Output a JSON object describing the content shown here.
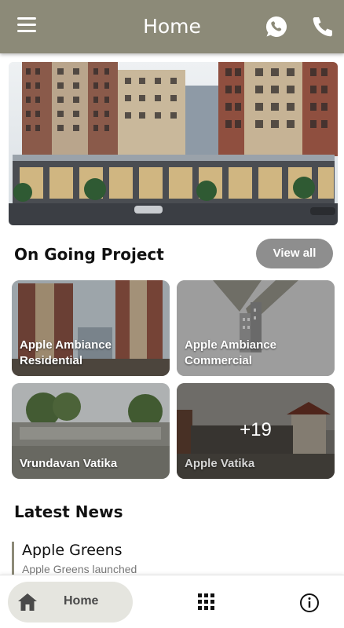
{
  "header": {
    "title": "Home",
    "menu_icon": "hamburger-menu-icon",
    "whatsapp_icon": "whatsapp-icon",
    "phone_icon": "phone-icon",
    "background_color": "#8c8a78"
  },
  "ongoing": {
    "title": "On Going Project",
    "view_all_label": "View all",
    "projects": [
      {
        "line1": "Apple Ambiance",
        "line2": "Residential"
      },
      {
        "line1": "Apple Ambiance",
        "line2": "Commercial"
      },
      {
        "line1": "Vrundavan Vatika",
        "line2": ""
      },
      {
        "line1": "Apple Vatika",
        "line2": "",
        "more_count": "+19"
      }
    ]
  },
  "news": {
    "title": "Latest News",
    "items": [
      {
        "title": "Apple Greens",
        "subtitle": "Apple Greens launched"
      }
    ]
  },
  "bottom_nav": {
    "home_label": "Home",
    "home_icon": "home-icon",
    "grid_icon": "grid-icon",
    "info_icon": "info-icon"
  }
}
